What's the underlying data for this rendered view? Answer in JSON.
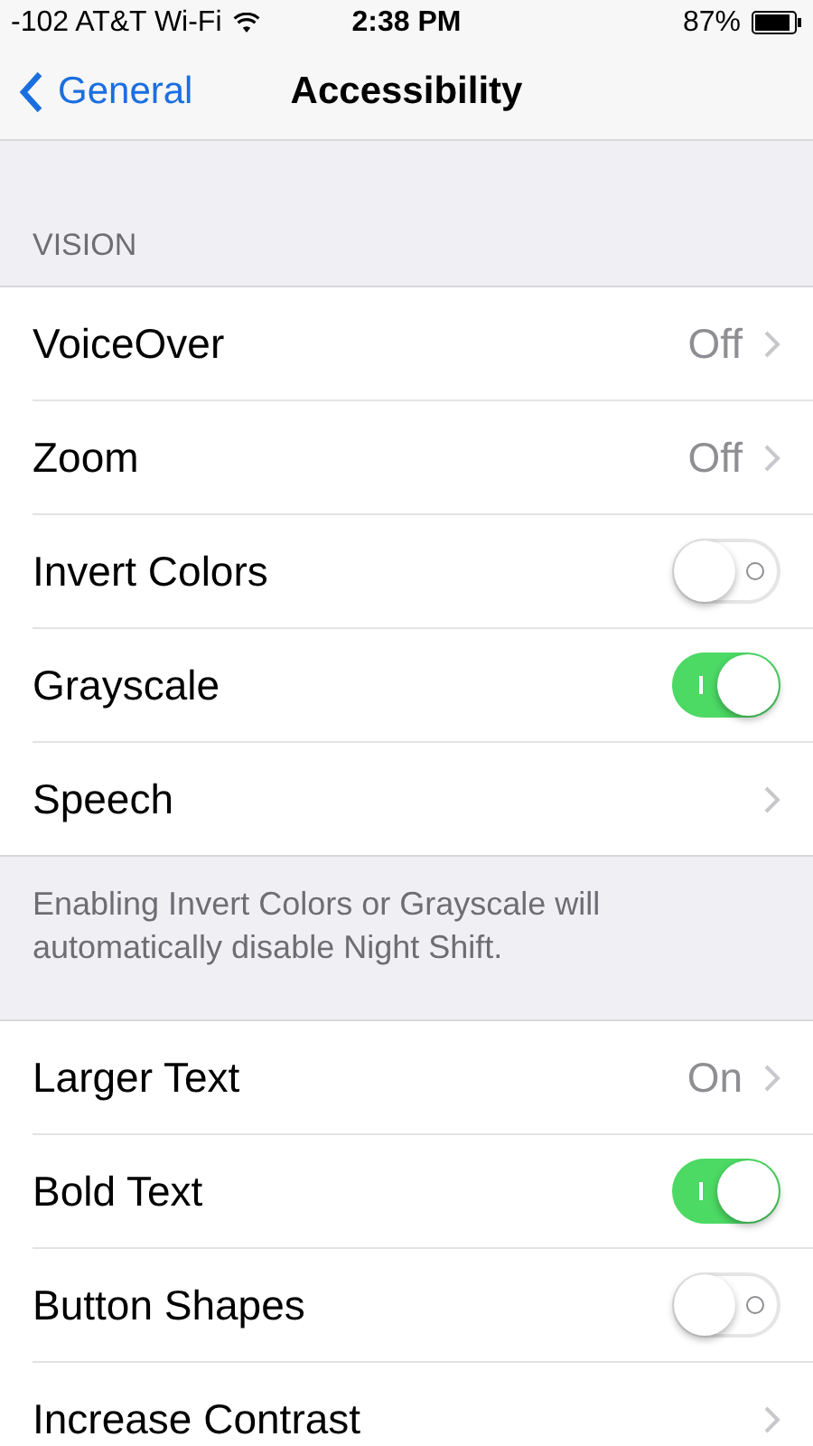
{
  "status_bar": {
    "carrier": "-102 AT&T Wi-Fi",
    "time": "2:38 PM",
    "battery": "87%"
  },
  "nav_bar": {
    "back": "General",
    "title": "Accessibility"
  },
  "sections": [
    {
      "header": "VISION",
      "rows": [
        {
          "kind": "link",
          "label": "VoiceOver",
          "value": "Off"
        },
        {
          "kind": "link",
          "label": "Zoom",
          "value": "Off"
        },
        {
          "kind": "toggle",
          "label": "Invert Colors",
          "on": false
        },
        {
          "kind": "toggle",
          "label": "Grayscale",
          "on": true
        },
        {
          "kind": "link",
          "label": "Speech"
        }
      ],
      "footer": "Enabling Invert Colors or Grayscale will automatically disable Night Shift."
    },
    {
      "rows": [
        {
          "kind": "link",
          "label": "Larger Text",
          "value": "On"
        },
        {
          "kind": "toggle",
          "label": "Bold Text",
          "on": true
        },
        {
          "kind": "toggle",
          "label": "Button Shapes",
          "on": false
        },
        {
          "kind": "link",
          "label": "Increase Contrast"
        }
      ]
    }
  ]
}
